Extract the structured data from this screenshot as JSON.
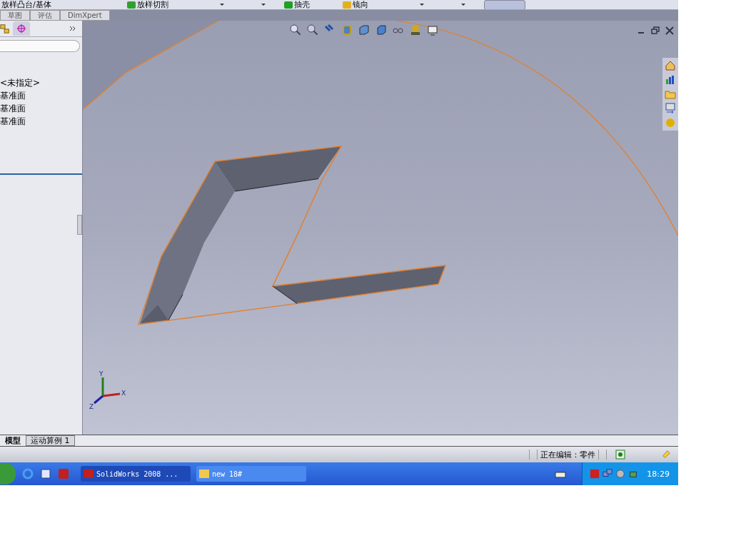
{
  "toolbar": {
    "items": [
      {
        "label": "放样凸台/基体",
        "kind": "boss"
      },
      {
        "label": "放样切割",
        "kind": "cut"
      },
      {
        "label": "抽壳",
        "kind": "shell"
      },
      {
        "label": "镜向",
        "kind": "mirror"
      }
    ]
  },
  "command_tabs": [
    {
      "label": "草图",
      "selected": false
    },
    {
      "label": "评估",
      "selected": false
    },
    {
      "label": "DimXpert",
      "selected": false
    }
  ],
  "feature_tree": {
    "items": [
      "<未指定>",
      "基准面",
      "基准面",
      "基准面"
    ]
  },
  "triad": {
    "x": "X",
    "y": "Y",
    "z": "Z"
  },
  "model_tabs": [
    {
      "label": "模型",
      "selected": true
    },
    {
      "label": "运动算例 1",
      "selected": false
    }
  ],
  "status_bar": {
    "text": "正在编辑：零件"
  },
  "taskbar": {
    "tasks": [
      {
        "label": "SolidWorks 2008 ...",
        "selected": true
      },
      {
        "label": "new 18#",
        "selected": false
      }
    ],
    "clock": "18:29"
  }
}
